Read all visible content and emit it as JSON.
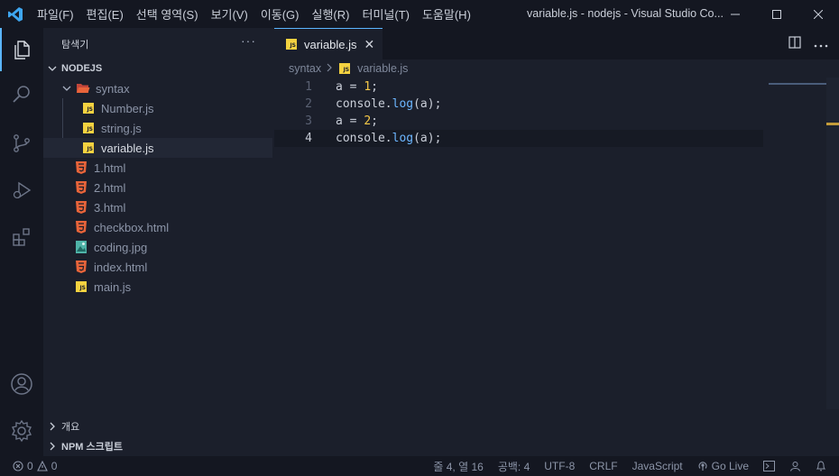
{
  "titlebar": {
    "menus": [
      "파일(F)",
      "편집(E)",
      "선택 영역(S)",
      "보기(V)",
      "이동(G)",
      "실행(R)",
      "터미널(T)",
      "도움말(H)"
    ],
    "title": "variable.js - nodejs - Visual Studio Co..."
  },
  "sidebar": {
    "title": "탐색기",
    "more": "···",
    "root_folder": "NODEJS",
    "tree": [
      {
        "label": "syntax",
        "type": "folder"
      },
      {
        "label": "Number.js",
        "type": "js"
      },
      {
        "label": "string.js",
        "type": "js"
      },
      {
        "label": "variable.js",
        "type": "js",
        "selected": true
      },
      {
        "label": "1.html",
        "type": "html"
      },
      {
        "label": "2.html",
        "type": "html"
      },
      {
        "label": "3.html",
        "type": "html"
      },
      {
        "label": "checkbox.html",
        "type": "html"
      },
      {
        "label": "coding.jpg",
        "type": "image"
      },
      {
        "label": "index.html",
        "type": "html"
      },
      {
        "label": "main.js",
        "type": "js"
      }
    ],
    "outline_section": "개요",
    "npm_section": "NPM 스크립트"
  },
  "editor": {
    "tab_label": "variable.js",
    "tab_close": "✕",
    "breadcrumb": [
      "syntax",
      "variable.js"
    ],
    "lines": [
      {
        "num": "1",
        "parts": [
          {
            "t": "a = ",
            "k": "plain"
          },
          {
            "t": "1",
            "k": "num"
          },
          {
            "t": ";",
            "k": "plain"
          }
        ]
      },
      {
        "num": "2",
        "parts": [
          {
            "t": "console.",
            "k": "plain"
          },
          {
            "t": "log",
            "k": "fn"
          },
          {
            "t": "(a);",
            "k": "plain"
          }
        ]
      },
      {
        "num": "3",
        "parts": [
          {
            "t": "a = ",
            "k": "plain"
          },
          {
            "t": "2",
            "k": "num"
          },
          {
            "t": ";",
            "k": "plain"
          }
        ]
      },
      {
        "num": "4",
        "parts": [
          {
            "t": "console.",
            "k": "plain"
          },
          {
            "t": "log",
            "k": "fn"
          },
          {
            "t": "(a);",
            "k": "plain"
          }
        ],
        "current": true
      }
    ]
  },
  "statusbar": {
    "errors": "0",
    "warnings": "0",
    "position": "줄 4, 열 16",
    "spaces": "공백: 4",
    "encoding": "UTF-8",
    "eol": "CRLF",
    "language": "JavaScript",
    "golive": "Go Live"
  },
  "colors": {
    "accent": "#5bb5ff",
    "js": "#f5d240",
    "html": "#e8643a",
    "folder": "#e8643a",
    "image": "#4fb3a8"
  }
}
